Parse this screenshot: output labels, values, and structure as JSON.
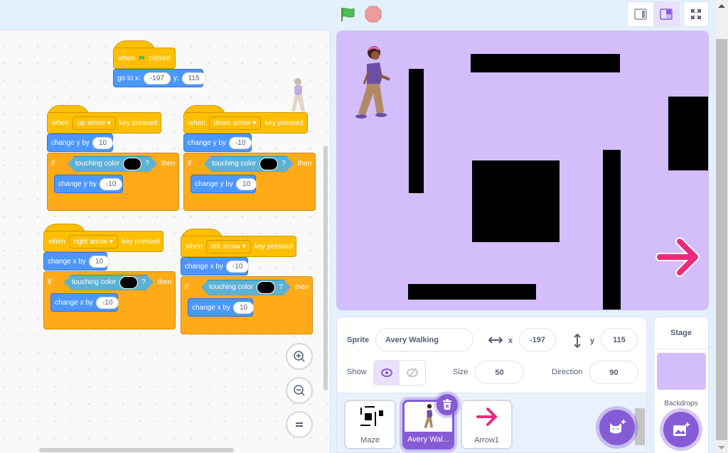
{
  "toolbar": {
    "green_flag_icon": "green-flag-icon",
    "stop_icon": "stop-sign-icon",
    "layout_small_stage_icon": "small-stage-icon",
    "layout_normal_stage_icon": "normal-stage-icon",
    "fullscreen_icon": "fullscreen-icon",
    "colors": {
      "flag": "#4cbf56",
      "stop": "#ec9c9c",
      "accent": "#855cd6"
    }
  },
  "code_area": {
    "scripts": [
      {
        "hat": {
          "when": "when",
          "event": "clicked",
          "icon": "green-flag-icon"
        },
        "blocks": [
          {
            "text": "go to x:",
            "x": "-197",
            "y_label": "y:",
            "y": "115"
          }
        ]
      },
      {
        "hat": {
          "when": "when",
          "key": "up arrow",
          "suffix": "key pressed"
        },
        "change": {
          "text": "change y by",
          "value": "10"
        },
        "if": {
          "if": "if",
          "condition": "touching color",
          "question": "?",
          "then": "then"
        },
        "inner": {
          "text": "change y by",
          "value": "-10"
        }
      },
      {
        "hat": {
          "when": "when",
          "key": "down arrow",
          "suffix": "key pressed"
        },
        "change": {
          "text": "change y by",
          "value": "-10"
        },
        "if": {
          "if": "if",
          "condition": "touching color",
          "question": "?",
          "then": "then"
        },
        "inner": {
          "text": "change y by",
          "value": "10"
        }
      },
      {
        "hat": {
          "when": "when",
          "key": "right arrow",
          "suffix": "key pressed"
        },
        "change": {
          "text": "change x by",
          "value": "10"
        },
        "if": {
          "if": "if",
          "condition": "touching color",
          "question": "?",
          "then": "then"
        },
        "inner": {
          "text": "change x by",
          "value": "-10"
        }
      },
      {
        "hat": {
          "when": "when",
          "key": "left arrow",
          "suffix": "key pressed"
        },
        "change": {
          "text": "change x by",
          "value": "-10"
        },
        "if": {
          "if": "if",
          "condition": "touching color",
          "question": "?",
          "then": "then"
        },
        "inner": {
          "text": "change x by",
          "value": "10"
        }
      }
    ],
    "zoom_in_icon": "zoom-in-icon",
    "zoom_out_icon": "zoom-out-icon",
    "reset_zoom_icon": "reset-zoom-icon",
    "colors": {
      "events": "#ffbf00",
      "motion": "#4c97ff",
      "control": "#ffab19",
      "sensing": "#5cb1d6"
    }
  },
  "stage": {
    "background": "#d4bdfb",
    "sprites": [
      "Avery Walking",
      "Arrow1",
      "Maze"
    ]
  },
  "sprite_info": {
    "sprite_label": "Sprite",
    "sprite_name": "Avery Walking",
    "x_label": "x",
    "x_value": "-197",
    "y_label": "y",
    "y_value": "115",
    "show_label": "Show",
    "size_label": "Size",
    "size_value": "50",
    "direction_label": "Direction",
    "direction_value": "90"
  },
  "sprite_list": {
    "sprites": [
      {
        "name": "Maze",
        "selected": false
      },
      {
        "name": "Avery Wal...",
        "selected": true
      },
      {
        "name": "Arrow1",
        "selected": false
      }
    ]
  },
  "stage_pane": {
    "title": "Stage",
    "backdrops_label": "Backdrops"
  }
}
